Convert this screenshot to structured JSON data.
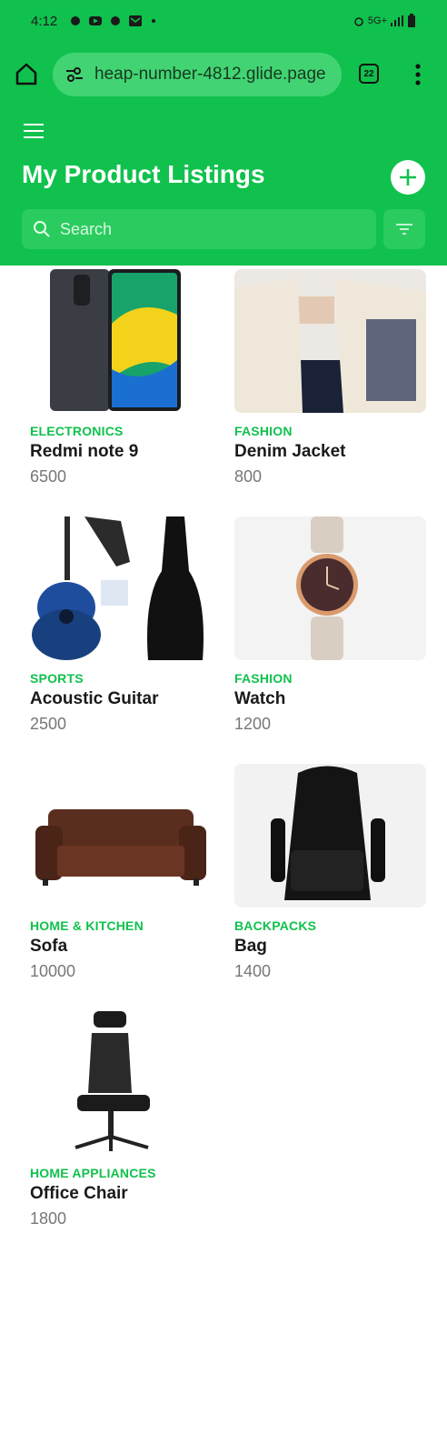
{
  "status_bar": {
    "time": "4:12",
    "network": "5G+"
  },
  "browser": {
    "url": "heap-number-4812.glide.page",
    "tab_count": "22"
  },
  "header": {
    "title": "My Product Listings"
  },
  "search": {
    "placeholder": "Search"
  },
  "theme": {
    "accent": "#10c14d"
  },
  "products": [
    {
      "category": "ELECTRONICS",
      "name": "Redmi note 9",
      "price": "6500",
      "image": "phone"
    },
    {
      "category": "FASHION",
      "name": "Denim Jacket",
      "price": "800",
      "image": "jacket"
    },
    {
      "category": "SPORTS",
      "name": "Acoustic Guitar",
      "price": "2500",
      "image": "guitar"
    },
    {
      "category": "FASHION",
      "name": "Watch",
      "price": "1200",
      "image": "watch"
    },
    {
      "category": "HOME & KITCHEN",
      "name": "Sofa",
      "price": "10000",
      "image": "sofa"
    },
    {
      "category": "BACKPACKS",
      "name": "Bag",
      "price": "1400",
      "image": "backpack"
    },
    {
      "category": "HOME APPLIANCES",
      "name": "Office Chair",
      "price": "1800",
      "image": "chair"
    }
  ]
}
